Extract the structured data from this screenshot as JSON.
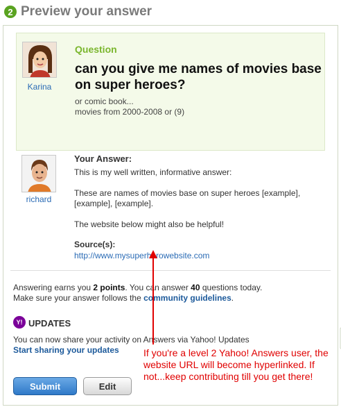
{
  "header": {
    "step": "2",
    "title": "Preview your answer"
  },
  "question": {
    "asker": "Karina",
    "label": "Question",
    "title": "can you give me names of movies base on super heroes?",
    "details": [
      "or comic book...",
      "movies from 2000-2008 or (9)"
    ]
  },
  "answer": {
    "author": "richard",
    "label": "Your Answer:",
    "paragraphs": [
      "This is my well written, informative answer:",
      "These are names of movies base on super heroes [example], [example], [example].",
      "The website below might also be helpful!"
    ],
    "sources_label": "Source(s):",
    "source_url": "http://www.mysuperherowebsite.com"
  },
  "points": {
    "line1_prefix": "Answering earns you ",
    "points_value": "2 points",
    "line1_mid": ". You can answer ",
    "questions_value": "40",
    "line1_suffix": " questions today.",
    "line2_prefix": "Make sure your answer follows the ",
    "guidelines_link": "community guidelines",
    "line2_suffix": "."
  },
  "updates": {
    "logo_text": "Y!",
    "title": "UPDATES",
    "text": "You can now share your activity on Answers via Yahoo! Updates",
    "link": "Start sharing your updates"
  },
  "buttons": {
    "submit": "Submit",
    "edit": "Edit"
  },
  "annotation": {
    "text": "If you're a level 2 Yahoo! Answers user, the website URL will become hyperlinked. If not...keep contributing till you get there!",
    "color": "#e00000"
  },
  "colors": {
    "accent_green": "#5aa321",
    "link_blue": "#2a6bb5",
    "yahoo_purple": "#7b0099"
  }
}
